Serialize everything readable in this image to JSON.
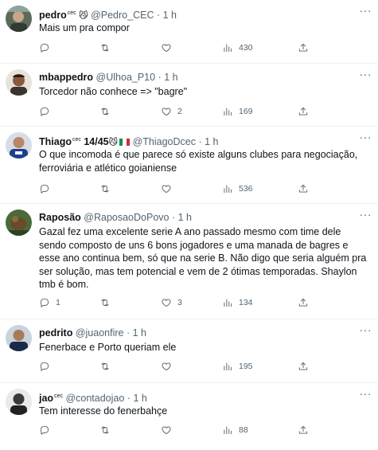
{
  "tweets": [
    {
      "name": "pedro",
      "badge": "cec",
      "name_emoji": "😼",
      "handle": "@Pedro_CEC",
      "separator": "·",
      "time": "1 h",
      "text": "Mais um pra compor",
      "replies": "",
      "retweets": "",
      "likes": "",
      "views": "430"
    },
    {
      "name": "mbappedro",
      "badge": "",
      "name_emoji": "",
      "handle": "@Ulhoa_P10",
      "separator": "·",
      "time": "1 h",
      "text": "Torcedor não conhece => \"bagre\"",
      "replies": "",
      "retweets": "",
      "likes": "2",
      "views": "169"
    },
    {
      "name": "Thiago",
      "badge": "cec",
      "name_suffix": " 14/45",
      "name_emoji": "😼",
      "flag": "Italy",
      "handle": "@ThiagoDcec",
      "separator": "·",
      "time": "1 h",
      "text": "O que incomoda é que parece só existe alguns clubes para negociação, ferroviária e atlético goianiense",
      "replies": "",
      "retweets": "",
      "likes": "",
      "views": "536"
    },
    {
      "name": "Raposão",
      "badge": "",
      "name_emoji": "",
      "handle": "@RaposaoDoPovo",
      "separator": "·",
      "time": "1 h",
      "text": "Gazal fez uma excelente serie A ano passado mesmo com time dele sendo composto de uns 6 bons jogadores e uma manada de bagres e esse ano continua bem, só que na serie B. Não digo que seria alguém pra ser solução, mas tem potencial e vem de 2 ótimas temporadas. Shaylon tmb é bom.",
      "replies": "1",
      "retweets": "",
      "likes": "3",
      "views": "134"
    },
    {
      "name": "pedrito",
      "badge": "",
      "name_emoji": "",
      "handle": "@juaonfire",
      "separator": "·",
      "time": "1 h",
      "text": "Fenerbace e Porto queriam ele",
      "replies": "",
      "retweets": "",
      "likes": "",
      "views": "195"
    },
    {
      "name": "jao",
      "badge": "cec",
      "name_emoji": "",
      "handle": "@contadojao",
      "separator": "·",
      "time": "1 h",
      "text": "Tem interesse do fenerbahçe",
      "replies": "",
      "retweets": "",
      "likes": "",
      "views": "88"
    }
  ],
  "more_label": "···",
  "colors": {
    "text": "#0f1419",
    "secondary": "#536471",
    "divider": "#eff3f4"
  },
  "icons": [
    "reply-icon",
    "retweet-icon",
    "like-icon",
    "views-icon",
    "share-icon",
    "more-icon"
  ]
}
